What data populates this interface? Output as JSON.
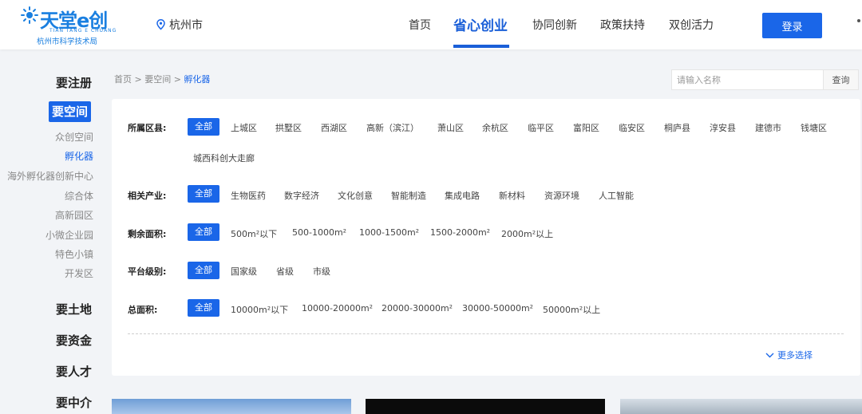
{
  "header": {
    "logo": {
      "main": "天堂e创",
      "pinyin": "TIAN TANG E CHUANG",
      "sub": "杭州市科学技术局"
    },
    "city": "杭州市",
    "nav": [
      {
        "label": "首页",
        "active": false
      },
      {
        "label": "省心创业",
        "active": true
      },
      {
        "label": "协同创新",
        "active": false
      },
      {
        "label": "政策扶持",
        "active": false
      },
      {
        "label": "双创活力",
        "active": false
      }
    ],
    "login_label": "登录"
  },
  "sidebar": {
    "sections": [
      "要注册",
      "要空间",
      "要土地",
      "要资金",
      "要人才",
      "要中介"
    ],
    "active_section": "要空间",
    "sub_items": [
      "众创空间",
      "孵化器",
      "海外孵化器创新中心",
      "综合体",
      "高新园区",
      "小微企业园",
      "特色小镇",
      "开发区"
    ],
    "active_sub": "孵化器"
  },
  "breadcrumb": {
    "home": "首页",
    "sep": ">",
    "level2": "要空间",
    "current": "孵化器"
  },
  "search": {
    "placeholder": "请输入名称",
    "button": "查询"
  },
  "filters": {
    "district": {
      "label": "所属区县:",
      "options": [
        "全部",
        "上城区",
        "拱墅区",
        "西湖区",
        "高新（滨江）",
        "萧山区",
        "余杭区",
        "临平区",
        "富阳区",
        "临安区",
        "桐庐县",
        "淳安县",
        "建德市",
        "钱塘区",
        "城西科创大走廊"
      ]
    },
    "industry": {
      "label": "相关产业:",
      "options": [
        "全部",
        "生物医药",
        "数字经济",
        "文化创意",
        "智能制造",
        "集成电路",
        "新材料",
        "资源环境",
        "人工智能"
      ]
    },
    "remaining_area": {
      "label": "剩余面积:",
      "options": [
        "全部",
        "500m²以下",
        "500-1000m²",
        "1000-1500m²",
        "1500-2000m²",
        "2000m²以上"
      ]
    },
    "platform_level": {
      "label": "平台级别:",
      "options": [
        "全部",
        "国家级",
        "省级",
        "市级"
      ]
    },
    "total_area": {
      "label": "总面积:",
      "options": [
        "全部",
        "10000m²以下",
        "10000-20000m²",
        "20000-30000m²",
        "30000-50000m²",
        "50000m²以上"
      ]
    },
    "more_label": "更多选择"
  },
  "colors": {
    "primary": "#1a66e8",
    "nav_active": "#1a5fd8",
    "background": "#f2f4f7"
  }
}
